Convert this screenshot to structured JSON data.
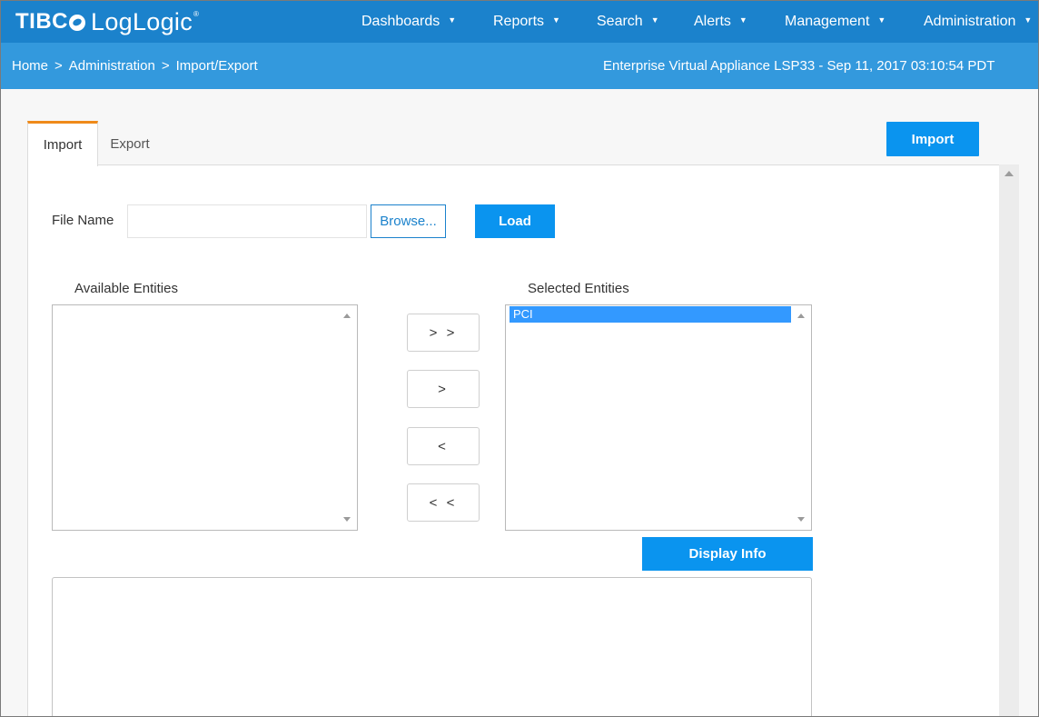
{
  "app": {
    "logo_text_a": "TIBC",
    "logo_text_b": "LogLogic",
    "logo_reg": "®"
  },
  "nav": {
    "items": [
      {
        "label": "Dashboards",
        "caret": "▼"
      },
      {
        "label": "Reports",
        "caret": "▼"
      },
      {
        "label": "Search",
        "caret": "▼"
      },
      {
        "label": "Alerts",
        "caret": "▼"
      },
      {
        "label": "Management",
        "caret": "▼"
      },
      {
        "label": "Administration",
        "caret": "▼"
      }
    ]
  },
  "breadcrumb": {
    "items": [
      "Home",
      "Administration",
      "Import/Export"
    ],
    "separator": ">"
  },
  "appliance_info": "Enterprise Virtual Appliance LSP33 - Sep 11, 2017 03:10:54 PDT",
  "tabs": [
    {
      "label": "Import",
      "active": true
    },
    {
      "label": "Export",
      "active": false
    }
  ],
  "actions": {
    "import_label": "Import",
    "load_label": "Load",
    "browse_label": "Browse...",
    "display_info_label": "Display Info"
  },
  "form": {
    "file_name_label": "File Name",
    "file_name_value": ""
  },
  "entities": {
    "available_label": "Available Entities",
    "selected_label": "Selected Entities",
    "available_items": [],
    "selected_items": [
      "PCI"
    ]
  },
  "move_buttons": {
    "add_all": "> >",
    "add": ">",
    "remove": "<",
    "remove_all": "< <"
  },
  "info_text": "",
  "colors": {
    "nav_bg": "#1b82cc",
    "breadcrumb_bg": "#3399dd",
    "primary_button": "#0a94ef",
    "active_tab_accent": "#ef8a1a",
    "selection": "#3399ff"
  }
}
